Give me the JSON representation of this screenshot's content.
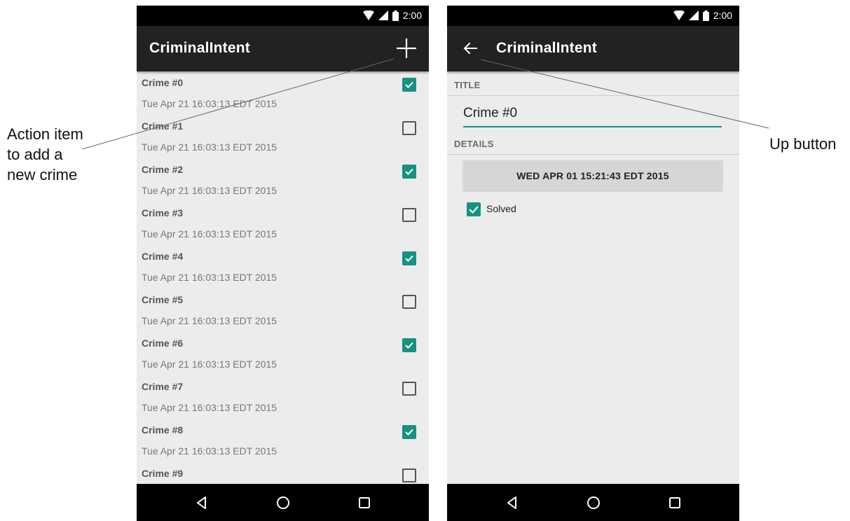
{
  "callouts": {
    "left_lines": [
      "Action item",
      "to add a",
      "new crime"
    ],
    "right_text": "Up button"
  },
  "status": {
    "time": "2:00",
    "icons": [
      "wifi-icon",
      "signal-icon",
      "battery-icon"
    ]
  },
  "list_screen": {
    "app_title": "CriminalIntent",
    "add_icon": "plus-icon",
    "crimes": [
      {
        "title": "Crime #0",
        "date": "Tue Apr 21 16:03:13 EDT 2015",
        "solved": true
      },
      {
        "title": "Crime #1",
        "date": "Tue Apr 21 16:03:13 EDT 2015",
        "solved": false
      },
      {
        "title": "Crime #2",
        "date": "Tue Apr 21 16:03:13 EDT 2015",
        "solved": true
      },
      {
        "title": "Crime #3",
        "date": "Tue Apr 21 16:03:13 EDT 2015",
        "solved": false
      },
      {
        "title": "Crime #4",
        "date": "Tue Apr 21 16:03:13 EDT 2015",
        "solved": true
      },
      {
        "title": "Crime #5",
        "date": "Tue Apr 21 16:03:13 EDT 2015",
        "solved": false
      },
      {
        "title": "Crime #6",
        "date": "Tue Apr 21 16:03:13 EDT 2015",
        "solved": true
      },
      {
        "title": "Crime #7",
        "date": "Tue Apr 21 16:03:13 EDT 2015",
        "solved": false
      },
      {
        "title": "Crime #8",
        "date": "Tue Apr 21 16:03:13 EDT 2015",
        "solved": true
      },
      {
        "title": "Crime #9",
        "date": "",
        "solved": false
      }
    ]
  },
  "detail_screen": {
    "app_title": "CriminalIntent",
    "up_icon": "arrow-left-icon",
    "title_label": "TITLE",
    "title_value": "Crime #0",
    "details_label": "DETAILS",
    "date_button": "WED APR 01 15:21:43 EDT 2015",
    "solved_label": "Solved",
    "solved": true
  },
  "nav": {
    "icons": [
      "back-icon",
      "home-icon",
      "recents-icon"
    ]
  },
  "colors": {
    "accent": "#169182",
    "appbar": "#222222",
    "background": "#ececec"
  }
}
